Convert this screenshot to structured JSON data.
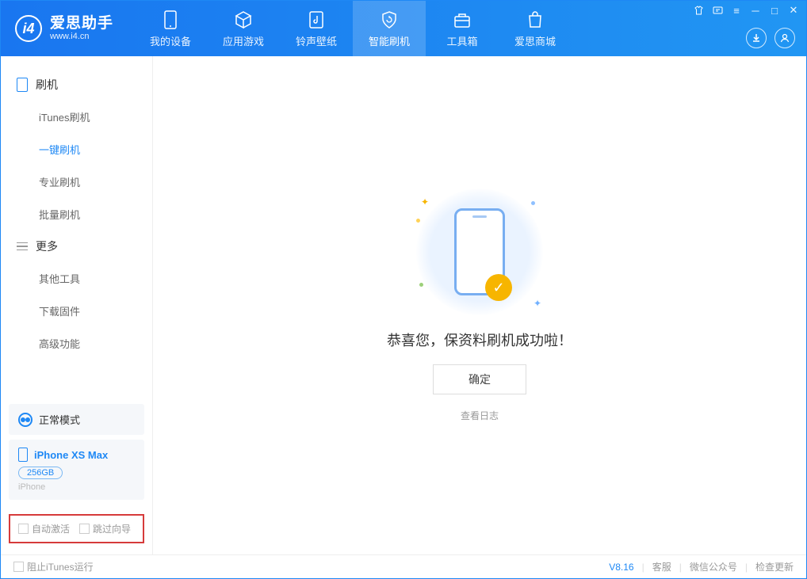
{
  "app": {
    "title": "爱思助手",
    "subtitle": "www.i4.cn"
  },
  "header": {
    "tabs": [
      {
        "label": "我的设备"
      },
      {
        "label": "应用游戏"
      },
      {
        "label": "铃声壁纸"
      },
      {
        "label": "智能刷机"
      },
      {
        "label": "工具箱"
      },
      {
        "label": "爱思商城"
      }
    ]
  },
  "sidebar": {
    "group1_title": "刷机",
    "group1_items": [
      "iTunes刷机",
      "一键刷机",
      "专业刷机",
      "批量刷机"
    ],
    "group2_title": "更多",
    "group2_items": [
      "其他工具",
      "下载固件",
      "高级功能"
    ],
    "status_label": "正常模式",
    "device": {
      "name": "iPhone XS Max",
      "storage": "256GB",
      "type": "iPhone"
    },
    "options": {
      "auto_activate": "自动激活",
      "skip_wizard": "跳过向导"
    }
  },
  "main": {
    "success_message": "恭喜您，保资料刷机成功啦！",
    "confirm_label": "确定",
    "view_log_label": "查看日志"
  },
  "footer": {
    "block_itunes": "阻止iTunes运行",
    "version": "V8.16",
    "links": [
      "客服",
      "微信公众号",
      "检查更新"
    ]
  }
}
